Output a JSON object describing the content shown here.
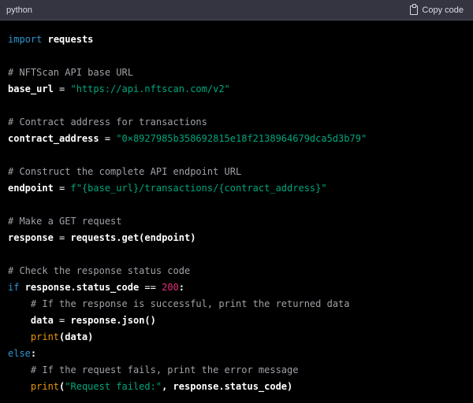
{
  "header": {
    "language": "python",
    "copy_label": "Copy code",
    "copy_icon": "clipboard-icon"
  },
  "colors": {
    "keyword": "#2e95d3",
    "string": "#00a67d",
    "number": "#df3079",
    "builtin": "#e9950c",
    "comment": "#a0a0a8",
    "header_bg": "#343541"
  },
  "code_lines": [
    [
      [
        "kw",
        "import"
      ],
      [
        "op",
        " "
      ],
      [
        "id",
        "requests"
      ]
    ],
    [],
    [
      [
        "cm",
        "# NFTScan API base URL"
      ]
    ],
    [
      [
        "id",
        "base_url"
      ],
      [
        "op",
        " = "
      ],
      [
        "str",
        "\"https://api.nftscan.com/v2\""
      ]
    ],
    [],
    [
      [
        "cm",
        "# Contract address for transactions"
      ]
    ],
    [
      [
        "id",
        "contract_address"
      ],
      [
        "op",
        " = "
      ],
      [
        "str",
        "\"0×8927985b358692815e18f2138964679dca5d3b79\""
      ]
    ],
    [],
    [
      [
        "cm",
        "# Construct the complete API endpoint URL"
      ]
    ],
    [
      [
        "id",
        "endpoint"
      ],
      [
        "op",
        " = "
      ],
      [
        "str",
        "f\"{base_url}/transactions/{contract_address}\""
      ]
    ],
    [],
    [
      [
        "cm",
        "# Make a GET request"
      ]
    ],
    [
      [
        "id",
        "response"
      ],
      [
        "op",
        " = "
      ],
      [
        "id",
        "requests.get(endpoint)"
      ]
    ],
    [],
    [
      [
        "cm",
        "# Check the response status code"
      ]
    ],
    [
      [
        "kw",
        "if"
      ],
      [
        "op",
        " "
      ],
      [
        "id",
        "response.status_code"
      ],
      [
        "op",
        " == "
      ],
      [
        "num",
        "200"
      ],
      [
        "id",
        ":"
      ]
    ],
    [
      [
        "op",
        "    "
      ],
      [
        "cm",
        "# If the response is successful, print the returned data"
      ]
    ],
    [
      [
        "op",
        "    "
      ],
      [
        "id",
        "data"
      ],
      [
        "op",
        " = "
      ],
      [
        "id",
        "response.json()"
      ]
    ],
    [
      [
        "op",
        "    "
      ],
      [
        "fn",
        "print"
      ],
      [
        "id",
        "(data)"
      ]
    ],
    [
      [
        "kw",
        "else"
      ],
      [
        "id",
        ":"
      ]
    ],
    [
      [
        "op",
        "    "
      ],
      [
        "cm",
        "# If the request fails, print the error message"
      ]
    ],
    [
      [
        "op",
        "    "
      ],
      [
        "fn",
        "print"
      ],
      [
        "id",
        "("
      ],
      [
        "str",
        "\"Request failed:\""
      ],
      [
        "id",
        ", response.status_code)"
      ]
    ]
  ]
}
